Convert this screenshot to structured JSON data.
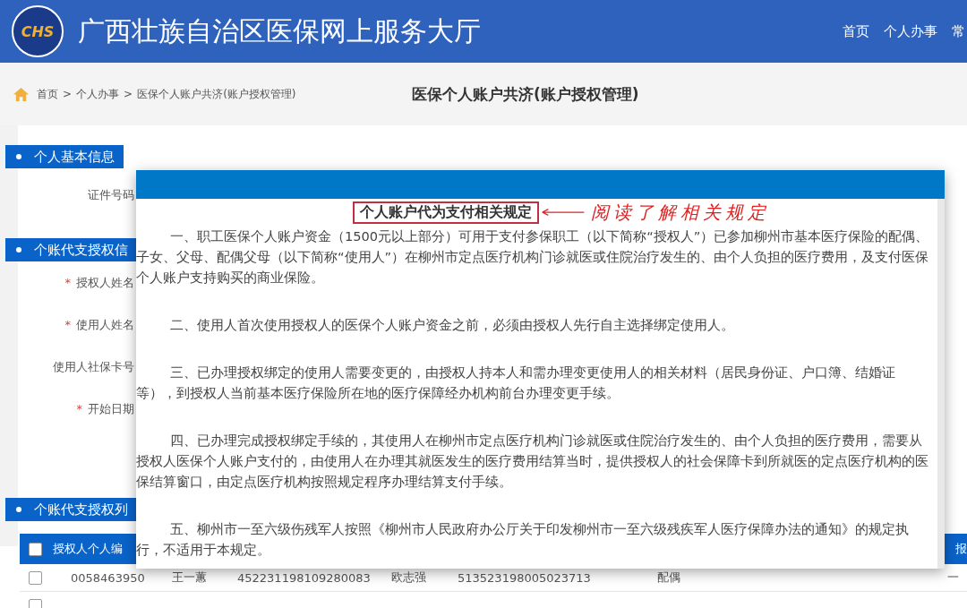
{
  "header": {
    "logo_text": "CHS",
    "title": "广西壮族自治区医保网上服务大厅",
    "nav": [
      {
        "label": "首页"
      },
      {
        "label": "个人办事"
      },
      {
        "label": "常"
      }
    ]
  },
  "breadcrumb": {
    "items": [
      "首页",
      "个人办事",
      "医保个人账户共济(账户授权管理)"
    ],
    "separator": ">"
  },
  "page_title": "医保个人账户共济(账户授权管理)",
  "sections": [
    {
      "title": "个人基本信息",
      "fields": [
        {
          "label": "证件号码",
          "required": false
        }
      ]
    },
    {
      "title": "个账代支授权信",
      "fields": [
        {
          "label": "授权人姓名",
          "required": true
        },
        {
          "label": "使用人姓名",
          "required": true
        },
        {
          "label": "使用人社保卡号",
          "required": false
        },
        {
          "label": "开始日期",
          "required": true
        }
      ]
    },
    {
      "title": "个账代支授权列"
    }
  ],
  "required_mark": "*",
  "table": {
    "columns": [
      "授权人个人编",
      "报"
    ],
    "select_all_checked": false,
    "rows": [
      {
        "checked": false,
        "cells": [
          "0058463950",
          "王一蕙",
          "452231198109280083",
          "欧志强",
          "513523198005023713",
          "配偶",
          "一"
        ]
      },
      {
        "checked": false,
        "cells": []
      }
    ]
  },
  "modal": {
    "title": "个人账户代为支付相关规定",
    "annotation": "阅读了解相关规定",
    "paragraphs": [
      "一、职工医保个人账户资金（1500元以上部分）可用于支付参保职工（以下简称“授权人”）已参加柳州市基本医疗保险的配偶、子女、父母、配偶父母（以下简称“使用人”）在柳州市定点医疗机构门诊就医或住院治疗发生的、由个人负担的医疗费用，及支付医保个人账户支持购买的商业保险。",
      "二、使用人首次使用授权人的医保个人账户资金之前，必须由授权人先行自主选择绑定使用人。",
      "三、已办理授权绑定的使用人需要变更的，由授权人持本人和需办理变更使用人的相关材料（居民身份证、户口簿、结婚证等），到授权人当前基本医疗保险所在地的医疗保障经办机构前台办理变更手续。",
      "四、已办理完成授权绑定手续的，其使用人在柳州市定点医疗机构门诊就医或住院治疗发生的、由个人负担的医疗费用，需要从授权人医保个人账户支付的，由使用人在办理其就医发生的医疗费用结算当时，提供授权人的社会保障卡到所就医的定点医疗机构的医保结算窗口，由定点医疗机构按照规定程序办理结算支付手续。",
      "五、柳州市一至六级伤残军人按照《柳州市人民政府办公厅关于印发柳州市一至六级残疾军人医疗保障办法的通知》的规定执行，不适用于本规定。"
    ]
  }
}
